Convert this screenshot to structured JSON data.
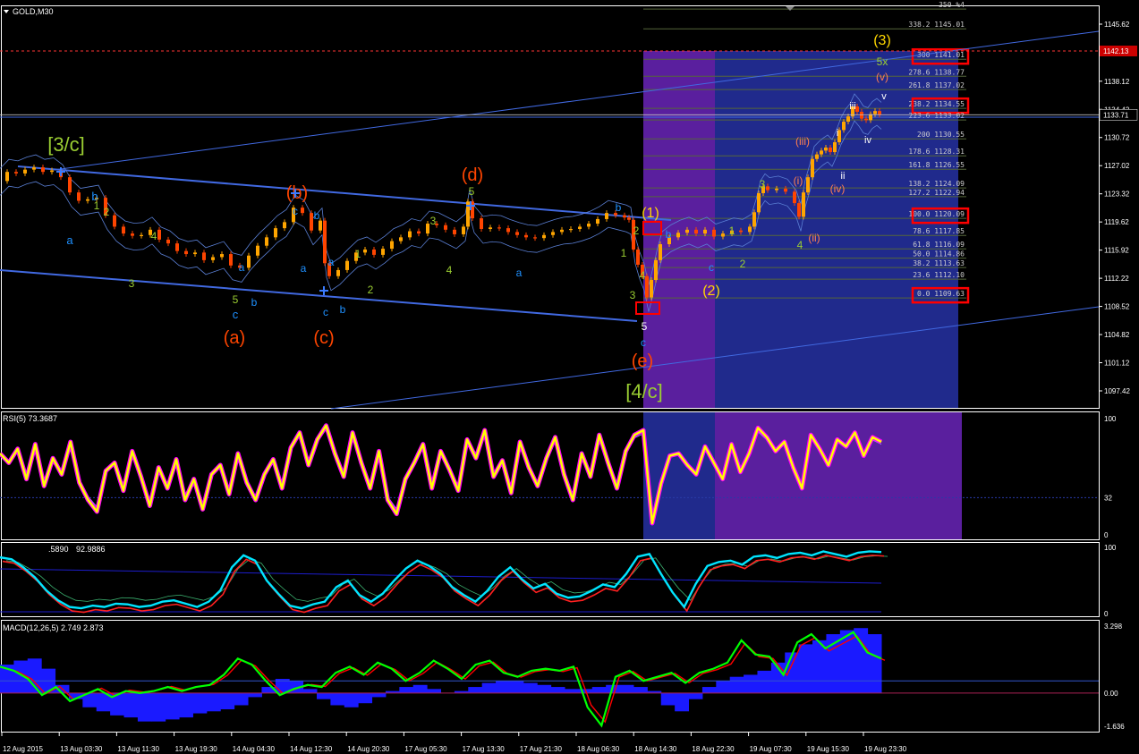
{
  "chart_title": "GOLD,M30",
  "colors": {
    "background": "#000000",
    "panel_border": "#ffffff",
    "axis_text": "#ffffff",
    "bull_candle": "#ffa500",
    "bear_candle": "#ff4500",
    "trend_line": "#4169e1",
    "fib_line": "#4a5a3a",
    "purple_zone": "#5a1f9e",
    "blue_zone": "#202a8c",
    "rsi_main": "#ffff00",
    "rsi_outline": "#ff00ff",
    "macd_hist": "#1a1aff",
    "macd_line": "#00ff00",
    "signal_line": "#ff0000",
    "current_price_box": "#cc0000"
  },
  "chart_data": [
    {
      "type": "candlestick",
      "panel": "main",
      "symbol": "GOLD",
      "timeframe": "M30",
      "ylim": [
        1097.42,
        1148.5
      ],
      "y_ticks": [
        "1145.62",
        "1142.11",
        "1138.12",
        "1134.42",
        "1130.72",
        "1127.02",
        "1123.32",
        "1119.62",
        "1115.92",
        "1112.22",
        "1108.52",
        "1104.82",
        "1101.12",
        "1097.42"
      ],
      "current_price": "1133.71",
      "current_price_box": "1142.13",
      "x_ticks": [
        "12 Aug 2015",
        "13 Aug 03:30",
        "13 Aug 11:30",
        "13 Aug 19:30",
        "14 Aug 04:30",
        "14 Aug 12:30",
        "14 Aug 20:30",
        "17 Aug 05:30",
        "17 Aug 13:30",
        "17 Aug 21:30",
        "18 Aug 06:30",
        "18 Aug 14:30",
        "18 Aug 22:30",
        "19 Aug 07:30",
        "19 Aug 15:30",
        "19 Aug 23:30"
      ],
      "price_path": [
        [
          0,
          1125.0
        ],
        [
          10,
          1126.2
        ],
        [
          20,
          1126.0
        ],
        [
          30,
          1126.5
        ],
        [
          40,
          1126.8
        ],
        [
          50,
          1126.2
        ],
        [
          60,
          1126.4
        ],
        [
          70,
          1125.5
        ],
        [
          80,
          1123.5
        ],
        [
          90,
          1122.4
        ],
        [
          100,
          1122.6
        ],
        [
          110,
          1122.8
        ],
        [
          120,
          1120.5
        ],
        [
          130,
          1119.0
        ],
        [
          140,
          1118.1
        ],
        [
          150,
          1117.8
        ],
        [
          160,
          1117.9
        ],
        [
          170,
          1118.6
        ],
        [
          180,
          1117.3
        ],
        [
          190,
          1116.8
        ],
        [
          200,
          1115.8
        ],
        [
          210,
          1115.4
        ],
        [
          220,
          1115.6
        ],
        [
          230,
          1114.6
        ],
        [
          240,
          1115.0
        ],
        [
          250,
          1115.4
        ],
        [
          260,
          1113.9
        ],
        [
          270,
          1113.6
        ],
        [
          280,
          1115.2
        ],
        [
          290,
          1116.5
        ],
        [
          300,
          1117.6
        ],
        [
          310,
          1118.8
        ],
        [
          320,
          1119.6
        ],
        [
          330,
          1121.5
        ],
        [
          340,
          1120.8
        ],
        [
          350,
          1118.5
        ],
        [
          360,
          1119.8
        ],
        [
          365,
          1114.2
        ],
        [
          370,
          1112.5
        ],
        [
          380,
          1113.3
        ],
        [
          390,
          1114.5
        ],
        [
          400,
          1115.6
        ],
        [
          410,
          1116.0
        ],
        [
          420,
          1115.3
        ],
        [
          430,
          1116.1
        ],
        [
          440,
          1117.1
        ],
        [
          450,
          1117.6
        ],
        [
          460,
          1118.4
        ],
        [
          470,
          1118.1
        ],
        [
          480,
          1119.4
        ],
        [
          490,
          1119.2
        ],
        [
          500,
          1118.6
        ],
        [
          510,
          1118.0
        ],
        [
          520,
          1119.0
        ],
        [
          525,
          1122.3
        ],
        [
          530,
          1120.1
        ],
        [
          540,
          1118.7
        ],
        [
          550,
          1118.9
        ],
        [
          560,
          1118.8
        ],
        [
          570,
          1118.3
        ],
        [
          580,
          1117.9
        ],
        [
          590,
          1117.6
        ],
        [
          600,
          1117.5
        ],
        [
          610,
          1117.9
        ],
        [
          620,
          1118.3
        ],
        [
          630,
          1118.6
        ],
        [
          640,
          1118.7
        ],
        [
          650,
          1119.0
        ],
        [
          660,
          1119.4
        ],
        [
          670,
          1120.0
        ],
        [
          680,
          1120.8
        ],
        [
          690,
          1120.5
        ],
        [
          700,
          1120.2
        ],
        [
          705,
          1119.9
        ],
        [
          710,
          1116.0
        ],
        [
          715,
          1114.0
        ],
        [
          720,
          1112.5
        ],
        [
          725,
          1109.7
        ],
        [
          730,
          1112.0
        ],
        [
          735,
          1114.6
        ],
        [
          740,
          1116.7
        ],
        [
          750,
          1117.6
        ],
        [
          760,
          1118.2
        ],
        [
          770,
          1118.6
        ],
        [
          780,
          1118.1
        ],
        [
          790,
          1118.6
        ],
        [
          800,
          1117.7
        ],
        [
          810,
          1118.1
        ],
        [
          820,
          1118.5
        ],
        [
          830,
          1118.3
        ],
        [
          840,
          1119.0
        ],
        [
          845,
          1120.9
        ],
        [
          850,
          1123.4
        ],
        [
          855,
          1124.3
        ],
        [
          860,
          1123.8
        ],
        [
          870,
          1124.0
        ],
        [
          880,
          1123.6
        ],
        [
          890,
          1122.1
        ],
        [
          895,
          1120.3
        ],
        [
          900,
          1123.5
        ],
        [
          905,
          1125.5
        ],
        [
          910,
          1127.9
        ],
        [
          915,
          1128.5
        ],
        [
          920,
          1129.0
        ],
        [
          925,
          1129.4
        ],
        [
          930,
          1128.8
        ],
        [
          935,
          1130.1
        ],
        [
          940,
          1131.7
        ],
        [
          945,
          1132.8
        ],
        [
          950,
          1133.5
        ],
        [
          955,
          1134.8
        ],
        [
          960,
          1134.1
        ],
        [
          965,
          1133.2
        ],
        [
          970,
          1133.0
        ],
        [
          975,
          1133.8
        ],
        [
          980,
          1134.2
        ],
        [
          985,
          1133.7
        ]
      ],
      "wave_labels": [
        {
          "text": "[3/c]",
          "color": "#9acd32"
        },
        {
          "text": "[4/c]",
          "color": "#9acd32"
        },
        {
          "text": "(a)",
          "color": "#ff4500"
        },
        {
          "text": "(b)",
          "color": "#ff4500"
        },
        {
          "text": "(c)",
          "color": "#ff4500"
        },
        {
          "text": "(d)",
          "color": "#ff4500"
        },
        {
          "text": "(e)",
          "color": "#ff4500"
        },
        {
          "text": "(1)",
          "color": "#ffd700"
        },
        {
          "text": "(2)",
          "color": "#ffd700"
        },
        {
          "text": "(3)",
          "color": "#ffd700"
        },
        {
          "text": "a",
          "color": "#1e90ff"
        },
        {
          "text": "b",
          "color": "#1e90ff"
        },
        {
          "text": "c",
          "color": "#1e90ff"
        },
        {
          "text": "(i)",
          "color": "#ff7f50"
        },
        {
          "text": "(ii)",
          "color": "#ff7f50"
        },
        {
          "text": "(iii)",
          "color": "#ff7f50"
        },
        {
          "text": "(iv)",
          "color": "#ff7f50"
        },
        {
          "text": "(v)",
          "color": "#ff7f50"
        },
        {
          "text": "i",
          "color": "#ffffff"
        },
        {
          "text": "ii",
          "color": "#ffffff"
        },
        {
          "text": "iii",
          "color": "#ffffff"
        },
        {
          "text": "iv",
          "color": "#ffffff"
        },
        {
          "text": "v",
          "color": "#ffffff"
        },
        {
          "text": "1",
          "color": "#9acd32"
        },
        {
          "text": "2",
          "color": "#9acd32"
        },
        {
          "text": "3",
          "color": "#9acd32"
        },
        {
          "text": "4",
          "color": "#9acd32"
        },
        {
          "text": "5",
          "color": "#9acd32"
        },
        {
          "text": "5x",
          "color": "#9acd32"
        }
      ],
      "fib_levels": [
        {
          "label": "350 %4",
          "value": 1147.6
        },
        {
          "label": "338.2 1145.01",
          "value": 1145.01
        },
        {
          "label": "300 1141.01",
          "value": 1141.01,
          "boxed": true
        },
        {
          "label": "278.6 1138.77",
          "value": 1138.77
        },
        {
          "label": "261.8 1137.02",
          "value": 1137.02
        },
        {
          "label": "238.2 1134.55",
          "value": 1134.55,
          "boxed": true
        },
        {
          "label": "223.6 1133.02",
          "value": 1133.02
        },
        {
          "label": "200 1130.55",
          "value": 1130.55
        },
        {
          "label": "178.6 1128.31",
          "value": 1128.31
        },
        {
          "label": "161.8 1126.55",
          "value": 1126.55
        },
        {
          "label": "138.2 1124.09",
          "value": 1124.09
        },
        {
          "label": "127.2 1122.94",
          "value": 1122.94
        },
        {
          "label": "100.0 1120.09",
          "value": 1120.09,
          "boxed": true
        },
        {
          "label": "78.6 1117.85",
          "value": 1117.85
        },
        {
          "label": "61.8 1116.09",
          "value": 1116.09
        },
        {
          "label": "50.0 1114.86",
          "value": 1114.86
        },
        {
          "label": "38.2 1113.63",
          "value": 1113.63
        },
        {
          "label": "23.6 1112.10",
          "value": 1112.1
        },
        {
          "label": "0.0 1109.63",
          "value": 1109.63,
          "boxed": true
        }
      ]
    },
    {
      "type": "line",
      "panel": "rsi",
      "label": "RSI(5) 73.3687",
      "ylim": [
        0,
        100
      ],
      "y_ticks": [
        "100",
        "32",
        "0"
      ],
      "values": [
        70,
        62,
        74,
        48,
        78,
        42,
        66,
        52,
        80,
        45,
        30,
        20,
        55,
        62,
        38,
        72,
        50,
        25,
        58,
        40,
        65,
        30,
        48,
        22,
        52,
        60,
        35,
        70,
        45,
        30,
        52,
        65,
        40,
        75,
        88,
        60,
        82,
        94,
        70,
        50,
        88,
        62,
        40,
        72,
        30,
        18,
        48,
        62,
        78,
        40,
        72,
        56,
        38,
        82,
        66,
        90,
        50,
        64,
        36,
        80,
        58,
        42,
        66,
        84,
        52,
        30,
        70,
        50,
        86,
        62,
        40,
        72,
        86,
        90,
        10,
        44,
        68,
        70,
        60,
        52,
        76,
        62,
        48,
        78,
        54,
        70,
        92,
        84,
        72,
        80,
        58,
        40,
        86,
        74,
        60,
        82,
        76,
        88,
        68,
        84,
        80
      ],
      "current": 73.3687
    },
    {
      "type": "line",
      "panel": "stochastic",
      "label_main": ".5890",
      "label_signal": "92.9886",
      "ylim": [
        0,
        100
      ],
      "y_ticks": [
        "100",
        "0"
      ],
      "values": [
        85,
        82,
        70,
        55,
        35,
        20,
        10,
        8,
        12,
        10,
        15,
        14,
        10,
        12,
        18,
        20,
        15,
        10,
        18,
        35,
        70,
        88,
        80,
        50,
        30,
        12,
        8,
        14,
        18,
        40,
        50,
        28,
        18,
        30,
        50,
        68,
        80,
        72,
        60,
        40,
        28,
        18,
        34,
        56,
        70,
        52,
        38,
        45,
        30,
        24,
        26,
        34,
        44,
        40,
        60,
        86,
        90,
        60,
        32,
        10,
        45,
        72,
        78,
        80,
        74,
        86,
        88,
        84,
        90,
        92,
        88,
        94,
        90,
        86,
        92,
        94,
        93
      ],
      "current": 92.9886
    },
    {
      "type": "bar",
      "panel": "macd",
      "label": "MACD(12,26,5) 2.749 2.873",
      "ylim": [
        -1.636,
        3.298
      ],
      "y_ticks": [
        "3.298",
        "0.00",
        "-1.636"
      ],
      "histogram": [
        1.4,
        1.6,
        1.7,
        1.2,
        0.4,
        -0.3,
        -0.7,
        -0.9,
        -1.1,
        -1.2,
        -1.4,
        -1.4,
        -1.3,
        -1.2,
        -1.0,
        -0.9,
        -0.8,
        -0.6,
        -0.2,
        0.3,
        0.7,
        0.6,
        0.2,
        -0.3,
        -0.6,
        -0.7,
        -0.5,
        -0.2,
        0.1,
        0.3,
        0.4,
        0.2,
        0.0,
        0.1,
        0.3,
        0.5,
        0.6,
        0.6,
        0.5,
        0.4,
        0.3,
        0.2,
        0.2,
        0.3,
        0.4,
        0.4,
        0.3,
        0.1,
        -0.6,
        -0.9,
        -0.3,
        0.3,
        0.6,
        0.8,
        0.9,
        1.1,
        1.5,
        2.0,
        2.4,
        2.6,
        2.9,
        3.1,
        3.2,
        2.9
      ],
      "macd_line": [
        1.3,
        1.1,
        0.7,
        -0.1,
        0.3,
        -0.4,
        -0.1,
        0.2,
        -0.2,
        0.1,
        0.0,
        0.1,
        0.3,
        0.1,
        0.3,
        0.4,
        0.9,
        1.7,
        1.4,
        0.6,
        -0.1,
        0.2,
        0.4,
        0.3,
        1.0,
        1.3,
        0.9,
        1.5,
        1.2,
        0.6,
        1.0,
        1.6,
        1.2,
        0.7,
        1.4,
        1.6,
        1.0,
        0.8,
        1.1,
        1.2,
        1.1,
        1.3,
        -0.7,
        -1.6,
        0.8,
        1.1,
        0.6,
        0.8,
        1.0,
        0.5,
        1.0,
        1.2,
        1.5,
        2.6,
        1.9,
        1.8,
        0.9,
        2.5,
        2.9,
        2.2,
        2.6,
        3.0,
        2.0,
        1.7
      ],
      "current_macd": 2.749,
      "current_signal": 2.873
    }
  ]
}
